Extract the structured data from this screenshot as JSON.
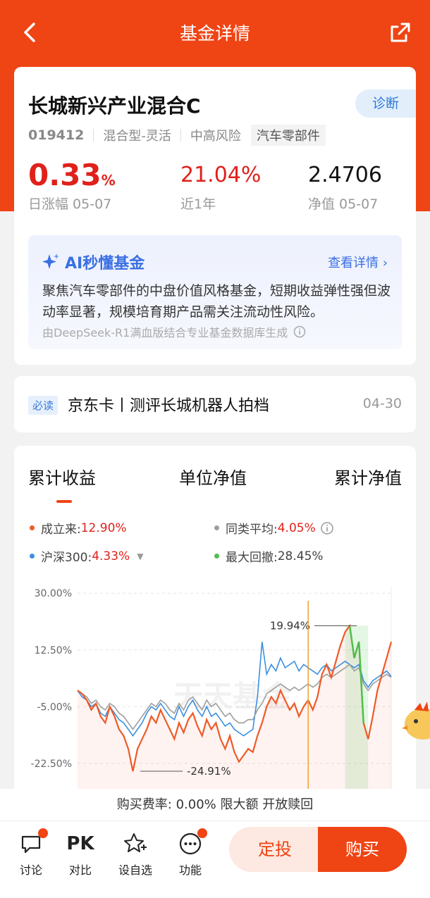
{
  "nav": {
    "title": "基金详情"
  },
  "fund": {
    "name": "长城新兴产业混合C",
    "diagnose": "诊断",
    "code": "019412",
    "type": "混合型-灵活",
    "risk": "中高风险",
    "sector": "汽车零部件",
    "daily_change": "0.33",
    "daily_unit": "%",
    "daily_label": "日涨幅 05-07",
    "year_return": "21.04%",
    "year_label": "近1年",
    "nav_value": "2.4706",
    "nav_label": "净值 05-07"
  },
  "ai": {
    "title": "AI秒懂基金",
    "more": "查看详情",
    "text": "聚焦汽车零部件的中盘价值风格基金，短期收益弹性强但波动率显著，规模培育期产品需关注流动性风险。",
    "note": "由DeepSeek-R1满血版结合专业基金数据库生成"
  },
  "news": {
    "tag": "必读",
    "title": "京东卡丨测评长城机器人拍档",
    "date": "04-30"
  },
  "tabs": [
    "累计收益",
    "单位净值",
    "累计净值"
  ],
  "legend": {
    "since_label": "成立来:",
    "since_value": "12.90%",
    "peer_label": "同类平均:",
    "peer_value": "4.05%",
    "hs300_label": "沪深300:",
    "hs300_value": "4.33%",
    "drawdown_label": "最大回撤:",
    "drawdown_value": "28.45%"
  },
  "colors": {
    "fund": "#ef5a28",
    "peer": "#9e9e9e",
    "hs300": "#3b8fe0",
    "drawdown": "#4cc04c",
    "accent": "#ef4414"
  },
  "chart_data": {
    "type": "line",
    "ylim": [
      -31,
      32
    ],
    "yticks": [
      "30.00%",
      "12.50%",
      "-5.00%",
      "-22.50%"
    ],
    "ytick_values": [
      30,
      12.5,
      -5,
      -22.5
    ],
    "annotations": [
      {
        "text": "19.94%",
        "x": 0.89,
        "y": 19.94
      },
      {
        "text": "-24.91%",
        "x": 0.2,
        "y": -24.91
      }
    ],
    "series": [
      {
        "name": "成立来",
        "values": [
          0,
          -1,
          -3,
          -6,
          -4,
          -8,
          -10,
          -5,
          -8,
          -12,
          -14,
          -18,
          -24.91,
          -18,
          -15,
          -12,
          -8,
          -10,
          -6,
          -9,
          -12,
          -15,
          -10,
          -13,
          -9,
          -7,
          -11,
          -14,
          -9,
          -12,
          -10,
          -15,
          -18,
          -14,
          -19,
          -22,
          -20,
          -18,
          -19,
          -14,
          -10,
          -5,
          -2,
          -4,
          0,
          -3,
          -6,
          -4,
          -8,
          -5,
          -3,
          -6,
          -2,
          5,
          8,
          4,
          9,
          14,
          18,
          19.94,
          10,
          15,
          -10,
          -15,
          -8,
          0,
          5,
          10,
          15
        ]
      },
      {
        "name": "同类平均",
        "values": [
          0,
          -1,
          -2,
          -4,
          -3,
          -5,
          -6,
          -4,
          -5,
          -7,
          -8,
          -10,
          -12,
          -10,
          -8,
          -6,
          -4,
          -5,
          -3,
          -4,
          -6,
          -7,
          -4,
          -6,
          -3,
          -2,
          -4,
          -6,
          -3,
          -5,
          -4,
          -6,
          -8,
          -7,
          -9,
          -10,
          -10,
          -9,
          -9,
          -6,
          -4,
          -1,
          0,
          1,
          2,
          1,
          0,
          1,
          0,
          1,
          2,
          1,
          2,
          4,
          5,
          4,
          5,
          6,
          7,
          8,
          6,
          7,
          2,
          0,
          2,
          3,
          4,
          5,
          4.05
        ]
      },
      {
        "name": "沪深300",
        "values": [
          0,
          -2,
          -3,
          -5,
          -4,
          -7,
          -8,
          -5,
          -7,
          -9,
          -10,
          -12,
          -14,
          -12,
          -10,
          -7,
          -5,
          -6,
          -4,
          -6,
          -8,
          -9,
          -5,
          -8,
          -5,
          -3,
          -6,
          -8,
          -5,
          -8,
          -7,
          -9,
          -11,
          -10,
          -12,
          -13,
          -14,
          -13,
          -12,
          -2,
          15,
          5,
          8,
          6,
          10,
          7,
          8,
          9,
          6,
          8,
          7,
          6,
          5,
          7,
          8,
          6,
          7,
          8,
          9,
          8,
          7,
          8,
          3,
          1,
          3,
          4,
          5,
          6,
          4.33
        ]
      }
    ]
  },
  "footer": {
    "fee": "购买费率: 0.00% 限大额 开放赎回",
    "items": [
      "讨论",
      "对比",
      "设自选",
      "功能"
    ],
    "pk": "PK",
    "dingtou": "定投",
    "buy": "购买"
  }
}
